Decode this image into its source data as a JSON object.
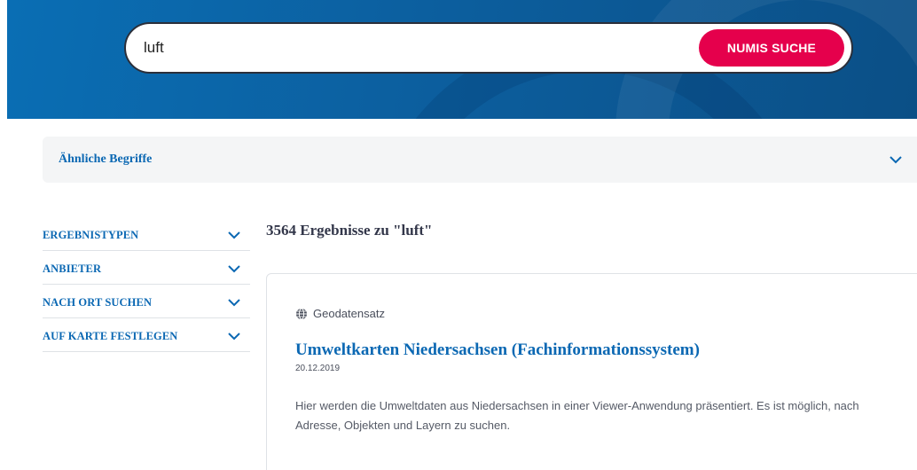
{
  "search": {
    "query": "luft",
    "button_label": "NUMIS SUCHE"
  },
  "similar_terms": {
    "label": "Ähnliche Begriffe"
  },
  "filters": {
    "items": [
      {
        "label": "ERGEBNISTYPEN"
      },
      {
        "label": "ANBIETER"
      },
      {
        "label": "NACH ORT SUCHEN"
      },
      {
        "label": "AUF KARTE FESTLEGEN"
      }
    ]
  },
  "results": {
    "count_text": "3564 Ergebnisse zu \"luft\"",
    "items": [
      {
        "type": "Geodatensatz",
        "type_icon": "globe-icon",
        "title": "Umweltkarten Niedersachsen (Fachinformationssystem)",
        "date": "20.12.2019",
        "description": "Hier werden die Umweltdaten aus Niedersachsen in einer Viewer-Anwendung präsentiert. Es ist möglich, nach Adresse, Objekten und Layern zu suchen."
      }
    ]
  },
  "colors": {
    "banner": "#0c5f9f",
    "search_button": "#e5004c",
    "link": "#0b68b3"
  }
}
